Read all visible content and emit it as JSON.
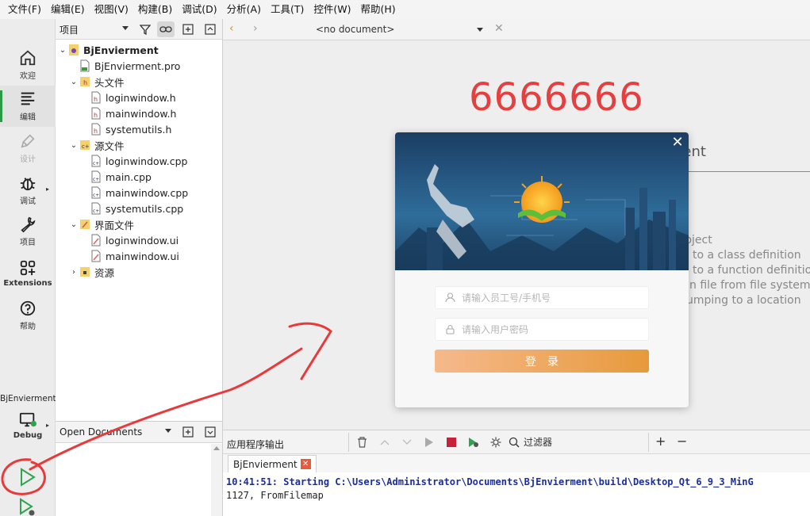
{
  "menubar": [
    "文件(F)",
    "编辑(E)",
    "视图(V)",
    "构建(B)",
    "调试(D)",
    "分析(A)",
    "工具(T)",
    "控件(W)",
    "帮助(H)"
  ],
  "modes": {
    "welcome": "欢迎",
    "edit": "编辑",
    "design": "设计",
    "debug": "调试",
    "projects": "项目",
    "extensions": "Extensions",
    "help": "帮助"
  },
  "kit": {
    "project": "BjEnvierment",
    "build_config": "Debug"
  },
  "project_panel": {
    "view_combo": "项目",
    "tree": [
      {
        "label": "BjEnvierment",
        "kind": "project",
        "bold": true
      },
      {
        "label": "BjEnvierment.pro",
        "kind": "pro"
      },
      {
        "label": "头文件",
        "kind": "folder-h"
      },
      {
        "label": "loginwindow.h",
        "kind": "header"
      },
      {
        "label": "mainwindow.h",
        "kind": "header"
      },
      {
        "label": "systemutils.h",
        "kind": "header"
      },
      {
        "label": "源文件",
        "kind": "folder-cpp"
      },
      {
        "label": "loginwindow.cpp",
        "kind": "cpp"
      },
      {
        "label": "main.cpp",
        "kind": "cpp"
      },
      {
        "label": "mainwindow.cpp",
        "kind": "cpp"
      },
      {
        "label": "systemutils.cpp",
        "kind": "cpp"
      },
      {
        "label": "界面文件",
        "kind": "folder-ui"
      },
      {
        "label": "loginwindow.ui",
        "kind": "ui"
      },
      {
        "label": "mainwindow.ui",
        "kind": "ui"
      },
      {
        "label": "资源",
        "kind": "folder-res"
      }
    ]
  },
  "open_documents": {
    "title": "Open Documents"
  },
  "editor": {
    "document": "<no document>",
    "big_text": "6666666",
    "welcome_partial": "nent",
    "hints": [
      "roject",
      "to a class definition",
      "to a function definitio",
      "n file from file system",
      "umping to a location"
    ]
  },
  "login_dialog": {
    "username_placeholder": "请输入员工号/手机号",
    "password_placeholder": "请输入用户密码",
    "login_label": "登录",
    "colors": {
      "button_start": "#f5b98c",
      "button_end": "#e79a3c"
    }
  },
  "output": {
    "pane_title": "应用程序输出",
    "filter_placeholder": "过滤器",
    "tab_label": "BjEnvierment",
    "line1": "10:41:51: Starting C:\\Users\\Administrator\\Documents\\BjEnvierment\\build\\Desktop_Qt_6_9_3_MinG",
    "line2": "1127, FromFilemap"
  },
  "colors": {
    "big_text": "#e53f3f",
    "active_mode": "#2b9a47",
    "annotation": "#e83a3a"
  }
}
